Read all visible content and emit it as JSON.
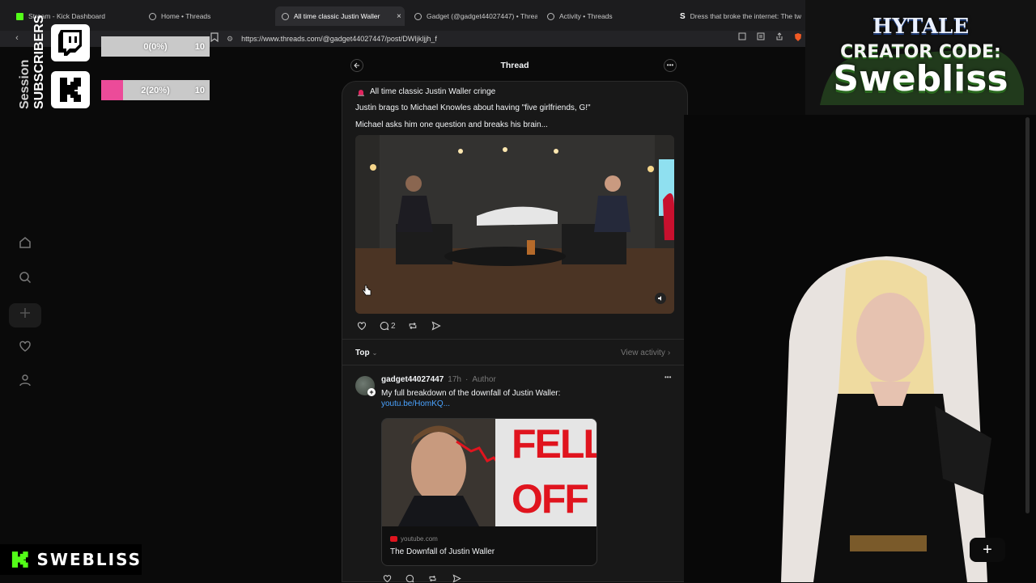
{
  "browser": {
    "tabs": [
      {
        "title": "Stream - Kick Dashboard",
        "favicon": "kick-icon",
        "active": false
      },
      {
        "title": "Home • Threads",
        "favicon": "threads-icon",
        "active": false
      },
      {
        "title": "All time classic Justin Waller",
        "favicon": "threads-icon",
        "active": true
      },
      {
        "title": "Gadget (@gadget44027447) • Threa",
        "favicon": "threads-icon",
        "active": false
      },
      {
        "title": "Activity • Threads",
        "favicon": "threads-icon",
        "active": false
      },
      {
        "title": "Dress that broke the internet: The tw",
        "favicon": "s-icon",
        "active": false
      }
    ],
    "close_glyph": "×",
    "url": "https://www.threads.com/@gadget44027447/post/DWIjkljjh_f"
  },
  "overlay": {
    "vertical_text_1": "Session",
    "vertical_text_2": "SUBSCRIBERS",
    "twitch": {
      "value": "0(0%)",
      "goal": "10",
      "progress": 0.0
    },
    "kick": {
      "value": "2(20%)",
      "goal": "10",
      "progress": 0.2
    },
    "channel_name": "SWEBLISS",
    "accent_kick": "#53fc18",
    "accent_bar": "#ec4b99"
  },
  "banner": {
    "game": "HYTALE",
    "line1": "CREATOR CODE:",
    "line2": "Swebliss"
  },
  "threads": {
    "header_title": "Thread",
    "post": {
      "line1": "All time classic Justin Waller cringe",
      "line2": "Justin brags to Michael Knowles about having \"five girlfriends, G!\"",
      "line3": "Michael asks him one question and breaks his brain...",
      "reply_count": "2"
    },
    "sort_label": "Top",
    "view_activity": "View activity",
    "reply": {
      "username": "gadget44027447",
      "time": "17h",
      "role": "Author",
      "text": "My full breakdown of the downfall of Justin Waller:",
      "link": "youtu.be/HomKQ...",
      "thumb_text_1": "FELL",
      "thumb_text_2": "OFF",
      "card_domain": "youtube.com",
      "card_title": "The Downfall of Justin Waller"
    }
  }
}
